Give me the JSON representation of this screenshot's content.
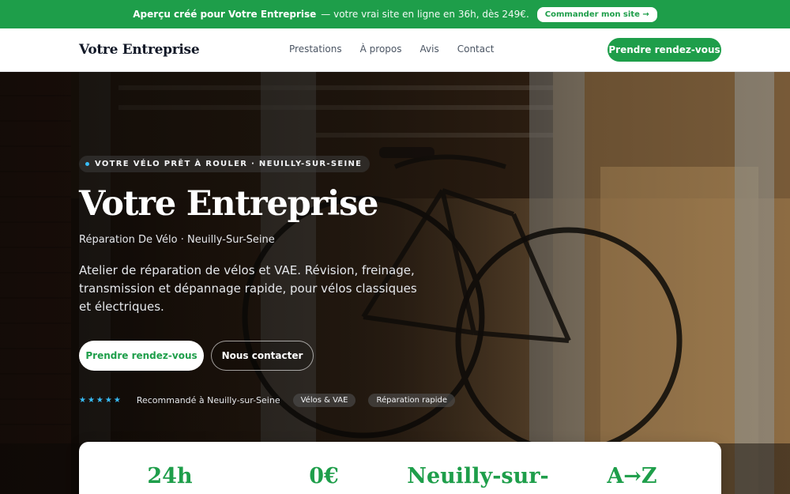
{
  "promo": {
    "lead": "Aperçu créé pour Votre Entreprise",
    "rest": "— votre vrai site en ligne en 36h, dès 249€.",
    "button": "Commander mon site →",
    "accent": "#1e9e4a"
  },
  "nav": {
    "brand": "Votre Entreprise",
    "links": [
      "Prestations",
      "À propos",
      "Avis",
      "Contact"
    ],
    "cta": "Prendre rendez-vous"
  },
  "hero": {
    "tagline": "VOTRE VÉLO PRÊT À ROULER · NEUILLY-SUR-SEINE",
    "title": "Votre Entreprise",
    "subtitle": "Réparation De Vélo · Neuilly-Sur-Seine",
    "description": "Atelier de réparation de vélos et VAE. Révision, freinage, transmission et dépannage rapide, pour vélos classiques et électriques.",
    "primary_button": "Prendre rendez-vous",
    "secondary_button": "Nous contacter",
    "stars": "★★★★★",
    "recommendation": "Recommandé à Neuilly-sur-Seine",
    "chips": [
      "Vélos & VAE",
      "Réparation rapide"
    ],
    "background_icon": "bike-workshop-photo",
    "star_color": "#38bdf8"
  },
  "stats": [
    "24h",
    "0€",
    "Neuilly-sur-",
    "A→Z"
  ]
}
